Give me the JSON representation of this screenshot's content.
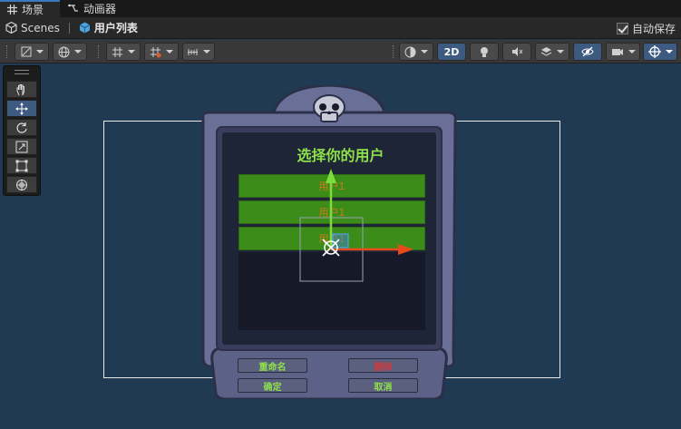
{
  "tabs": [
    {
      "label": "场景",
      "icon": "grid-icon"
    },
    {
      "label": "动画器",
      "icon": "animator-icon"
    }
  ],
  "breadcrumb": {
    "root": "Scenes",
    "current": "用户列表"
  },
  "autosave": {
    "label": "自动保存",
    "checked": true
  },
  "toolbar": {
    "mode_2d": "2D"
  },
  "dialog": {
    "title": "选择你的用户",
    "users": [
      "用户1",
      "用户1",
      "用户1"
    ],
    "buttons": {
      "rename": "重命名",
      "delete": "删除",
      "confirm": "确定",
      "cancel": "取消"
    }
  },
  "colors": {
    "scene_bg": "#1f3a52",
    "accent": "#3d5a80",
    "title_green": "#8ee04a",
    "row_green": "#3c8c1a",
    "row_text": "#d07a1a",
    "delete_red": "#d23a3a",
    "gizmo_y": "#7bdc3c",
    "gizmo_x": "#e84a1a"
  }
}
